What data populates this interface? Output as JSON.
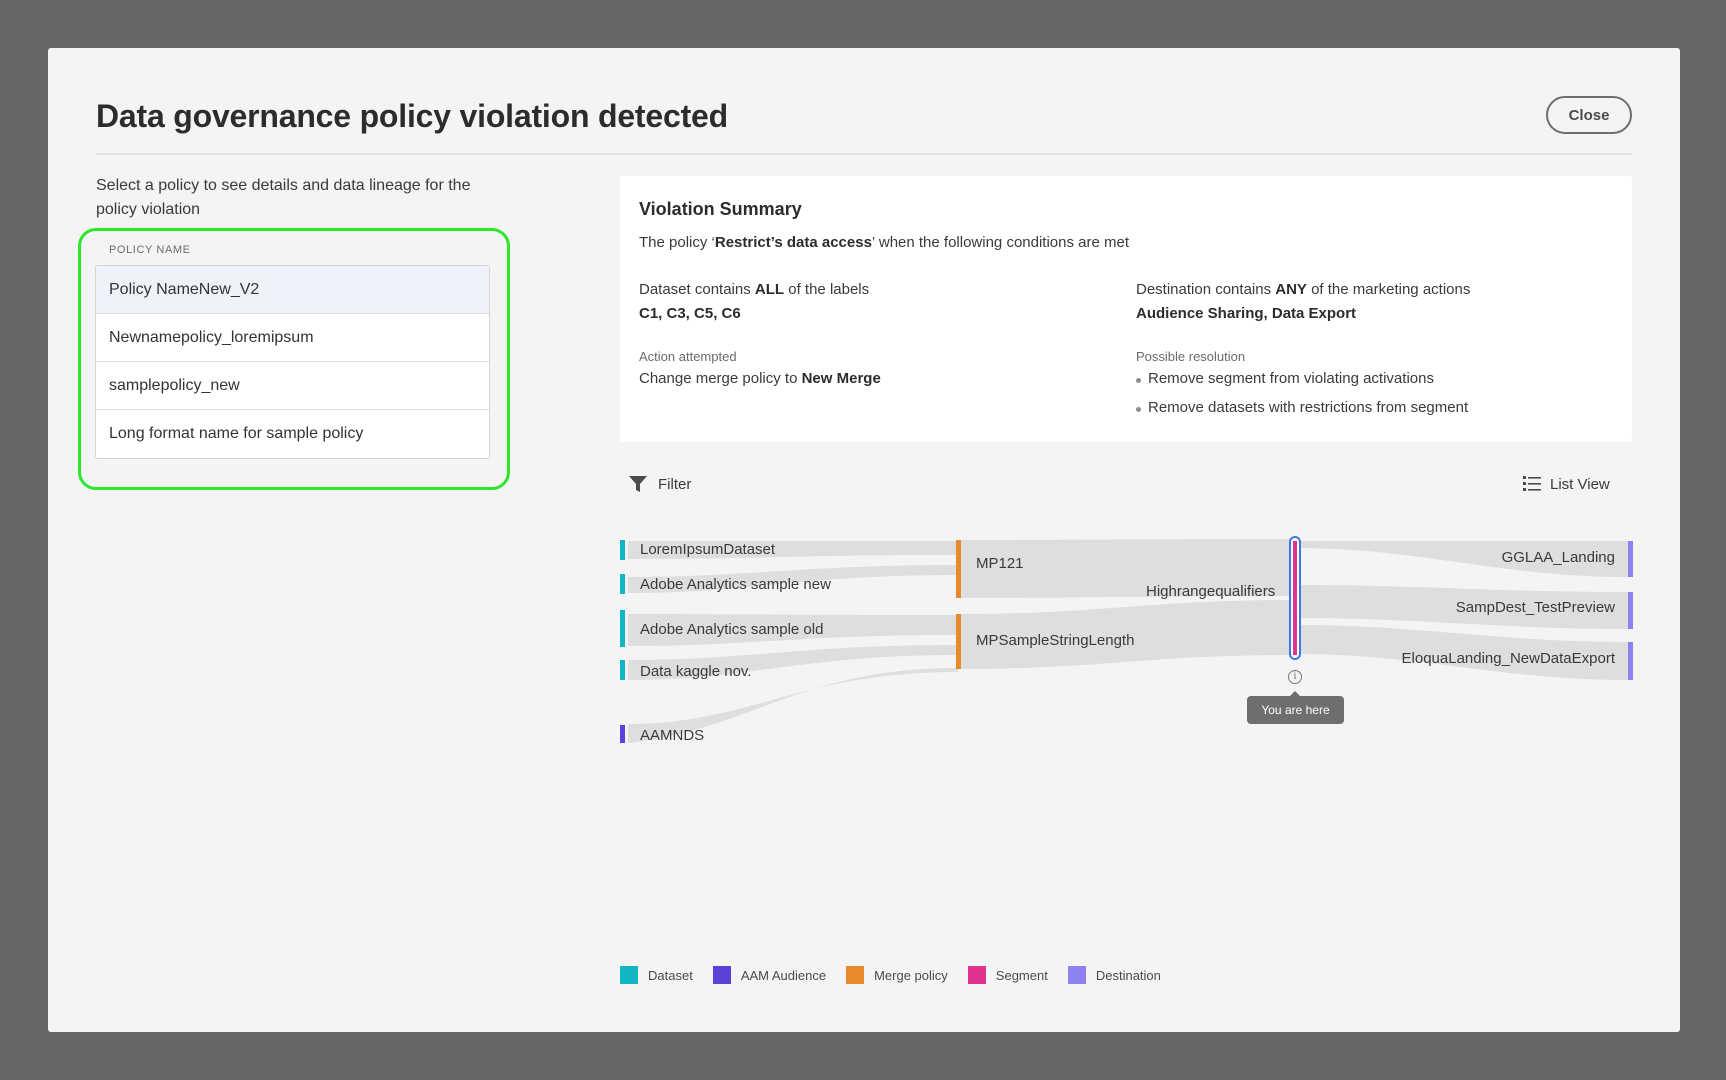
{
  "modal": {
    "title": "Data governance policy violation detected",
    "close_label": "Close"
  },
  "policies": {
    "intro": "Select a policy to see details and data lineage for the policy violation",
    "column_header": "POLICY NAME",
    "items": [
      {
        "label": "Policy NameNew_V2",
        "selected": true
      },
      {
        "label": "Newnamepolicy_loremipsum",
        "selected": false
      },
      {
        "label": "samplepolicy_new",
        "selected": false
      },
      {
        "label": "Long format name for sample policy",
        "selected": false
      }
    ]
  },
  "summary": {
    "heading": "Violation Summary",
    "policy_line": {
      "prefix": "The policy ‘",
      "policy_name": "Restrict’s data access",
      "suffix": "’ when the following conditions are met"
    },
    "dataset_condition": {
      "prefix": "Dataset contains ",
      "quantifier": "ALL",
      "suffix": " of the labels",
      "values": "C1, C3, C5, C6"
    },
    "destination_condition": {
      "prefix": "Destination contains ",
      "quantifier": "ANY",
      "suffix": " of the marketing actions",
      "values": "Audience Sharing,  Data Export"
    },
    "action": {
      "label": "Action attempted",
      "prefix": "Change merge policy to ",
      "value": "New Merge"
    },
    "resolution": {
      "label": "Possible resolution",
      "items": [
        "Remove segment from violating activations",
        "Remove datasets with restrictions from segment"
      ]
    }
  },
  "toolbar": {
    "filter_label": "Filter",
    "filter_icon": "funnel-icon",
    "list_view_label": "List View",
    "list_view_icon": "list-icon"
  },
  "lineage": {
    "datasets": [
      "LoremIpsumDataset",
      "Adobe Analytics sample new",
      "Adobe Analytics sample old",
      "Data kaggle nov."
    ],
    "audiences": [
      "AAMNDS"
    ],
    "merge_policies": [
      "MP121",
      "MPSampleStringLength"
    ],
    "segment": "Highrangequalifiers",
    "destinations": [
      "GGLAA_Landing",
      "SampDest_TestPreview",
      "EloquaLanding_NewDataExport"
    ],
    "you_are_here": "You are here",
    "info_glyph": "i"
  },
  "legend": [
    {
      "label": "Dataset",
      "color": "#12b5c4"
    },
    {
      "label": "AAM Audience",
      "color": "#5c40d8"
    },
    {
      "label": "Merge policy",
      "color": "#e8892b"
    },
    {
      "label": "Segment",
      "color": "#e0328f"
    },
    {
      "label": "Destination",
      "color": "#8c83f0"
    }
  ],
  "colors": {
    "highlight": "#2ee62e",
    "flow": "#dedede",
    "selection_ring": "#3b78e7"
  }
}
